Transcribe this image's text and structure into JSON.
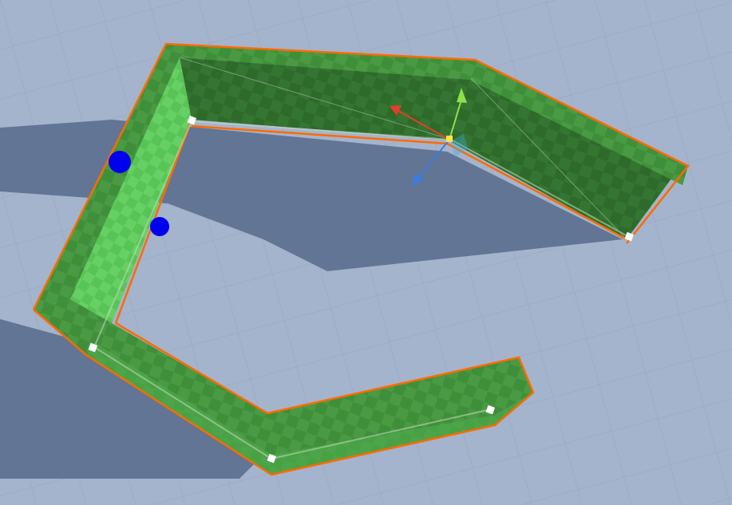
{
  "scene": {
    "view": "scene-view",
    "object": "green-wall-polyline",
    "selection_color": "#ff6a00"
  },
  "colors": {
    "ground": "#a4b4cc",
    "ground_grid": "#8c9bb3",
    "shadow": "#5d6f8c",
    "wall_top": "#3f8f3a",
    "wall_side_dark": "#2f6b2a",
    "wall_side_light": "#5cc85a",
    "handle": "#0000ee",
    "gizmo_x": "#e0402a",
    "gizmo_y": "#8ee04a",
    "gizmo_z": "#3a7de0",
    "gizmo_center": "#ffe24a",
    "control_point": "#ffffff"
  },
  "gizmo": {
    "name": "move-gizmo",
    "axes": [
      "x-axis-handle",
      "y-axis-handle",
      "z-axis-handle"
    ]
  },
  "handles": [
    "thickness-handle-outer",
    "thickness-handle-inner"
  ],
  "control_points": [
    "control-point-1",
    "control-point-2",
    "control-point-3",
    "control-point-4",
    "control-point-5"
  ]
}
